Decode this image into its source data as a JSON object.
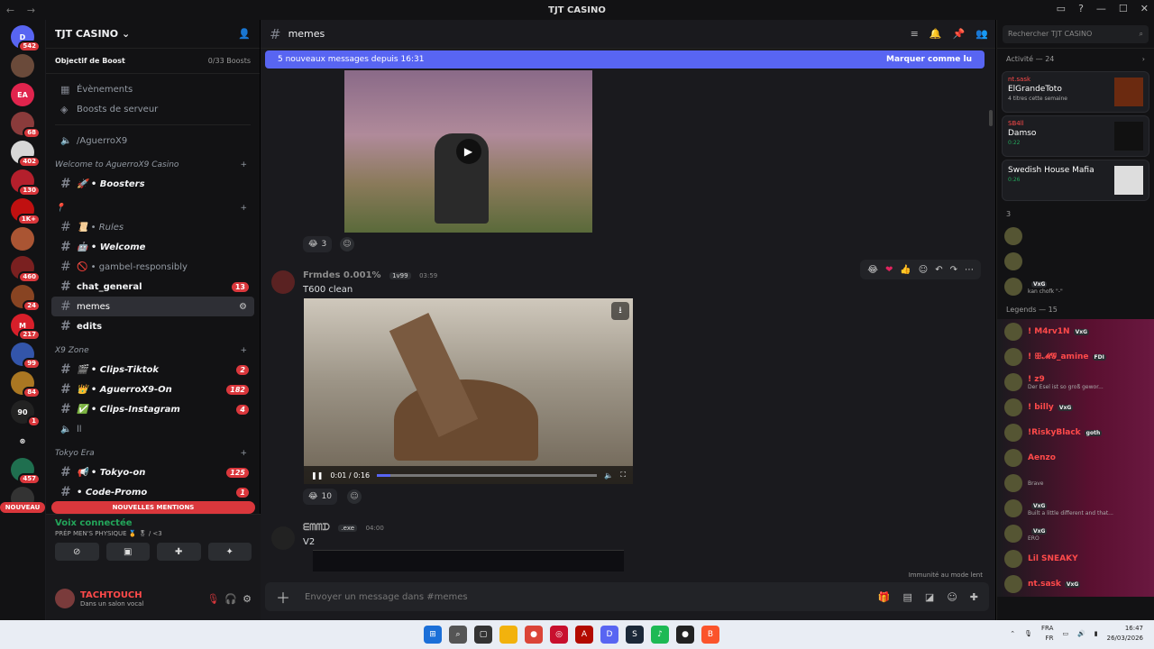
{
  "window": {
    "title": "TJT CASINO",
    "back": "←",
    "forward": "→",
    "controls": [
      "▭",
      "?",
      "—",
      "☐",
      "✕"
    ]
  },
  "servers": [
    {
      "label": "D",
      "color": "#5865f2",
      "badge": "542"
    },
    {
      "label": "",
      "color": "#6a4a3a",
      "badge": ""
    },
    {
      "label": "EA",
      "color": "#e0244d",
      "badge": ""
    },
    {
      "label": "",
      "color": "#8a3b3b",
      "badge": "68"
    },
    {
      "label": "",
      "color": "#d7d7d7",
      "badge": "402"
    },
    {
      "label": "",
      "color": "#b41f2c",
      "badge": "130"
    },
    {
      "label": "",
      "color": "#c01010",
      "badge": "1K+"
    },
    {
      "label": "",
      "color": "#aa5533",
      "badge": ""
    },
    {
      "label": "",
      "color": "#7a2020",
      "badge": "460"
    },
    {
      "label": "",
      "color": "#884422",
      "badge": "24"
    },
    {
      "label": "M",
      "color": "#d81f2a",
      "badge": "217"
    },
    {
      "label": "",
      "color": "#3355aa",
      "badge": "99"
    },
    {
      "label": "",
      "color": "#aa7722",
      "badge": "84"
    },
    {
      "label": "90",
      "color": "#222",
      "badge": "1"
    },
    {
      "label": "⊛",
      "color": "#121214",
      "badge": ""
    },
    {
      "label": "",
      "color": "#1f6f4f",
      "badge": "457"
    },
    {
      "label": "",
      "color": "#333",
      "badge": ""
    }
  ],
  "servers_new": "NOUVEAU",
  "guild": {
    "name": "TJT CASINO",
    "boost_goal": "Objectif de Boost",
    "boost_count": "0/33 Boosts",
    "top_items": [
      "Évènements",
      "Boosts de serveur"
    ],
    "voice_channel": "/AguerroX9",
    "categories": [
      {
        "name": "Welcome to AguerroX9 Casino",
        "channels": [
          {
            "name": "🚀 • Boosters",
            "style": "bold ital",
            "count": ""
          }
        ]
      },
      {
        "name": "📍",
        "channels": [
          {
            "name": "📜 • Rules",
            "style": "ital",
            "count": ""
          },
          {
            "name": "🤖 • Welcome",
            "style": "bold ital",
            "count": ""
          },
          {
            "name": "🚫 • gambel-responsibly",
            "style": "",
            "count": ""
          },
          {
            "name": "chat_general",
            "style": "bold",
            "count": "13"
          },
          {
            "name": "memes",
            "style": "active",
            "count": ""
          },
          {
            "name": "edits",
            "style": "bold",
            "count": ""
          }
        ]
      },
      {
        "name": "X9 Zone",
        "channels": [
          {
            "name": "🎬 • Clips-Tiktok",
            "style": "bold ital",
            "count": "2"
          },
          {
            "name": "👑 • AguerroX9-On",
            "style": "bold ital",
            "count": "182"
          },
          {
            "name": "✅ • Clips-Instagram",
            "style": "bold ital",
            "count": "4"
          },
          {
            "name": "ll",
            "style": "",
            "count": ""
          }
        ]
      },
      {
        "name": "Tokyo Era",
        "channels": [
          {
            "name": "📢 • Tokyo-on",
            "style": "bold ital",
            "count": "125"
          },
          {
            "name": "• Code-Promo",
            "style": "bold ital",
            "count": "1"
          }
        ]
      }
    ],
    "mentions": "NOUVELLES MENTIONS",
    "voice": {
      "status": "Voix connectée",
      "channel": "PRÉP MEN'S PHYSIQUE 🏅 🎖 / <3"
    },
    "user": {
      "name": "TACHTOUCH",
      "status": "Dans un salon vocal"
    }
  },
  "channel": {
    "name": "memes",
    "new_messages": "5 nouveaux messages depuis 16:31",
    "mark_read": "Marquer comme lu",
    "messages": [
      {
        "reaction": "😂",
        "count": "3"
      },
      {
        "author": "Frmdes 0.001%",
        "tag": "1v99",
        "time": "03:59",
        "text": "T600 clean",
        "video_time": "0:01 / 0:16",
        "progress": 0.06,
        "reaction": "😂",
        "count": "10"
      },
      {
        "author": "ᗴᗰᗰᗪ",
        "tag": ".exe",
        "time": "04:00",
        "text": "V2"
      }
    ],
    "immunity": "Immunité au mode lent",
    "composer": "Envoyer un message dans #memes"
  },
  "members": {
    "search": "Rechercher TJT CASINO",
    "activity": "Activité — 24",
    "activities": [
      {
        "name": "nt.sask",
        "title": "ElGrandeToto",
        "sub": "4 titres cette semaine",
        "green": false,
        "thumb": "#6b2a10"
      },
      {
        "name": "SB4ll",
        "title": "Damso",
        "sub": "0:22",
        "green": true,
        "thumb": "#111"
      },
      {
        "name": "",
        "title": "Swedish House Mafia",
        "sub": "0:26",
        "green": true,
        "thumb": "#ddd"
      }
    ],
    "section3": "3",
    "group3": [
      {
        "name": "",
        "status": "",
        "color": "#ff4a4a",
        "tag": ""
      },
      {
        "name": "",
        "status": "",
        "color": "#ff4a4a",
        "tag": ""
      },
      {
        "name": "",
        "status": "kan chofk \"-\"",
        "color": "#ff4a4a",
        "tag": "VxG"
      }
    ],
    "legends": "Legends — 15",
    "list": [
      {
        "name": "! M4rv1N",
        "status": "",
        "color": "#ff4a4a",
        "tag": "VxG"
      },
      {
        "name": "! ꕥ𝓜𝓖_amine",
        "status": "",
        "color": "#ff4a4a",
        "tag": "FDI"
      },
      {
        "name": "! z9",
        "status": "Der Esel ist so groß gewor...",
        "color": "#ff4a4a",
        "tag": ""
      },
      {
        "name": "! billy",
        "status": "",
        "color": "#ff4a4a",
        "tag": "VxG"
      },
      {
        "name": "!RiskyBlack",
        "status": "",
        "color": "#ff4a4a",
        "tag": "goth"
      },
      {
        "name": "Aenzo",
        "status": "",
        "color": "#ff4a4a",
        "tag": ""
      },
      {
        "name": "",
        "status": "Brave",
        "color": "#ff4a4a",
        "tag": ""
      },
      {
        "name": "",
        "status": "Built a little different and that...",
        "color": "#ff4a4a",
        "tag": "VxG"
      },
      {
        "name": "",
        "status": "ERO",
        "color": "#ff4a4a",
        "tag": "VxG"
      },
      {
        "name": "Lil SNEAKY",
        "status": "",
        "color": "#ff4a4a",
        "tag": ""
      },
      {
        "name": "nt.sask",
        "status": "",
        "color": "#ff4a4a",
        "tag": "VxG"
      }
    ]
  },
  "taskbar": {
    "lang": "FRA",
    "lang2": "FR",
    "time": "16:47",
    "date": "26/03/2026",
    "apps": [
      {
        "label": "⊞",
        "color": "#1b6fd8"
      },
      {
        "label": "⌕",
        "color": "#555"
      },
      {
        "label": "▢",
        "color": "#333"
      },
      {
        "label": "",
        "color": "#f2b20d"
      },
      {
        "label": "●",
        "color": "#db4437"
      },
      {
        "label": "◎",
        "color": "#c8102e"
      },
      {
        "label": "A",
        "color": "#b30b00"
      },
      {
        "label": "D",
        "color": "#5865f2"
      },
      {
        "label": "S",
        "color": "#1b2838"
      },
      {
        "label": "♪",
        "color": "#1db954"
      },
      {
        "label": "●",
        "color": "#222"
      },
      {
        "label": "B",
        "color": "#fb542b"
      }
    ]
  }
}
